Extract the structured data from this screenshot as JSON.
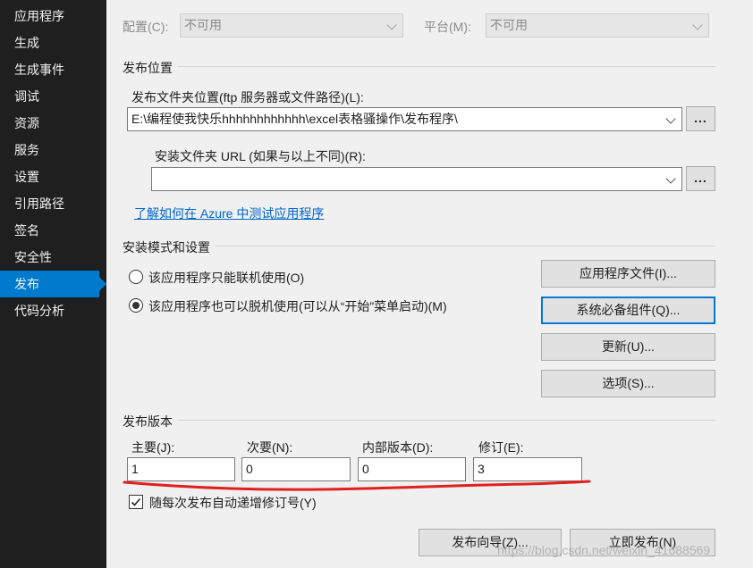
{
  "sidebar": {
    "items": [
      {
        "label": "应用程序"
      },
      {
        "label": "生成"
      },
      {
        "label": "生成事件"
      },
      {
        "label": "调试"
      },
      {
        "label": "资源"
      },
      {
        "label": "服务"
      },
      {
        "label": "设置"
      },
      {
        "label": "引用路径"
      },
      {
        "label": "签名"
      },
      {
        "label": "安全性"
      },
      {
        "label": "发布"
      },
      {
        "label": "代码分析"
      }
    ],
    "active_item": "发布"
  },
  "top_bar": {
    "config_label": "配置(C):",
    "config_value": "不可用",
    "platform_label": "平台(M):",
    "platform_value": "不可用"
  },
  "publish_location": {
    "group_title": "发布位置",
    "folder_label": "发布文件夹位置(ftp 服务器或文件路径)(L):",
    "folder_value": "E:\\编程使我快乐hhhhhhhhhhhh\\excel表格骚操作\\发布程序\\",
    "browse_label": "...",
    "install_url_label": "安装文件夹 URL (如果与以上不同)(R):",
    "install_url_value": "",
    "azure_link": "了解如何在 Azure 中测试应用程序"
  },
  "install_mode": {
    "group_title": "安装模式和设置",
    "online_only_label": "该应用程序只能联机使用(O)",
    "offline_label": "该应用程序也可以脱机使用(可以从“开始”菜单启动)(M)",
    "selected": "offline",
    "buttons": {
      "app_files": "应用程序文件(I)...",
      "prerequisites": "系统必备组件(Q)...",
      "updates": "更新(U)...",
      "options": "选项(S)..."
    }
  },
  "publish_version": {
    "group_title": "发布版本",
    "major_label": "主要(J):",
    "major_value": "1",
    "minor_label": "次要(N):",
    "minor_value": "0",
    "build_label": "内部版本(D):",
    "build_value": "0",
    "revision_label": "修订(E):",
    "revision_value": "3",
    "auto_increment_label": "随每次发布自动递增修订号(Y)",
    "auto_increment_checked": true,
    "annotation_color": "#e02020"
  },
  "footer": {
    "wizard_button": "发布向导(Z)...",
    "publish_now_button": "立即发布(N)",
    "watermark": "https://blog.csdn.net/weixin_41688569"
  }
}
